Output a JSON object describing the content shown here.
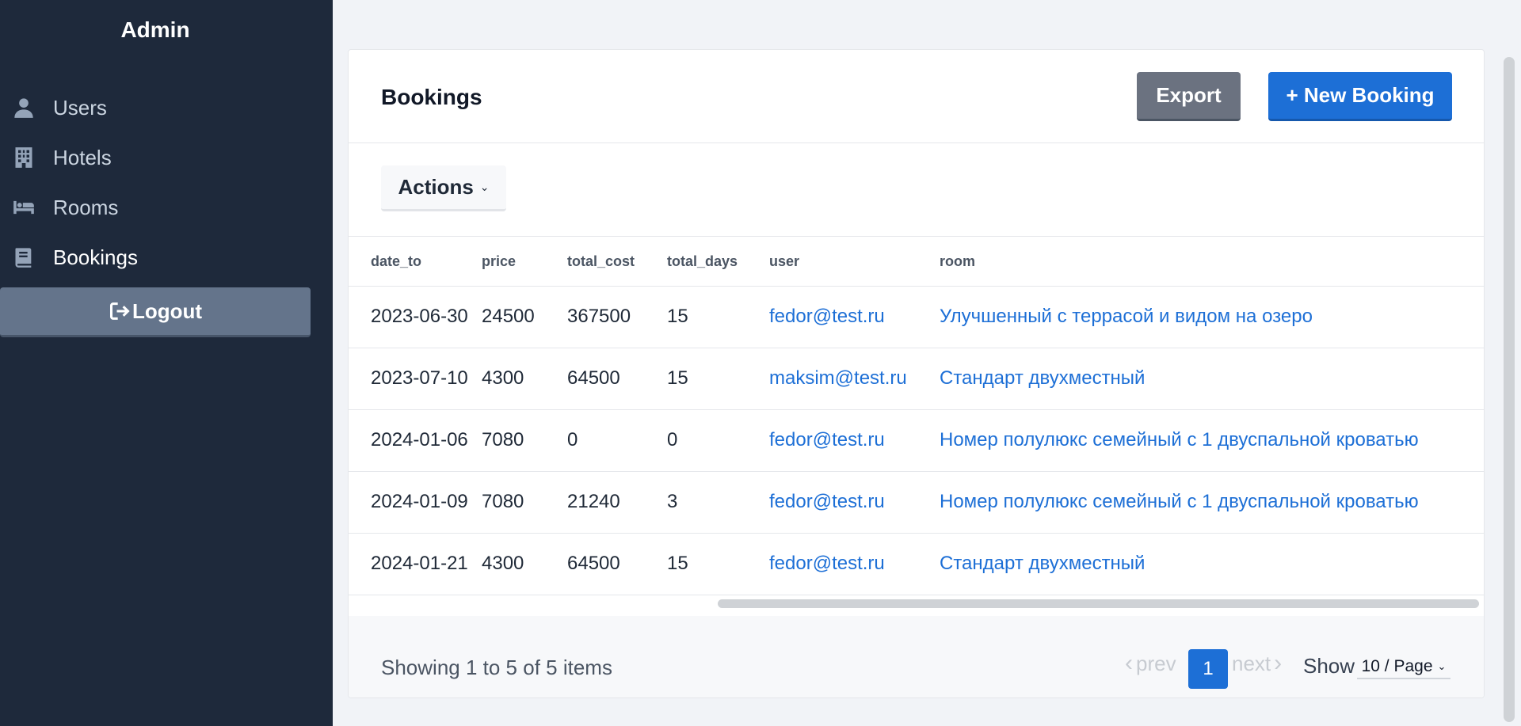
{
  "sidebar": {
    "brand": "Admin",
    "items": [
      {
        "label": "Users",
        "icon": "user-icon"
      },
      {
        "label": "Hotels",
        "icon": "building-icon"
      },
      {
        "label": "Rooms",
        "icon": "bed-icon"
      },
      {
        "label": "Bookings",
        "icon": "book-icon"
      }
    ],
    "active": "Bookings",
    "logout_label": "Logout"
  },
  "header": {
    "title": "Bookings",
    "export_label": "Export",
    "new_label": "+ New Booking"
  },
  "toolbar": {
    "actions_label": "Actions"
  },
  "table": {
    "columns": [
      "date_to",
      "price",
      "total_cost",
      "total_days",
      "user",
      "room"
    ],
    "rows": [
      [
        "2023-06-30",
        "24500",
        "367500",
        "15",
        "fedor@test.ru",
        "Улучшенный с террасой и видом на озеро"
      ],
      [
        "2023-07-10",
        "4300",
        "64500",
        "15",
        "maksim@test.ru",
        "Стандарт двухместный"
      ],
      [
        "2024-01-06",
        "7080",
        "0",
        "0",
        "fedor@test.ru",
        "Номер полулюкс семейный с 1 двуспальной кроватью"
      ],
      [
        "2024-01-09",
        "7080",
        "21240",
        "3",
        "fedor@test.ru",
        "Номер полулюкс семейный с 1 двуспальной кроватью"
      ],
      [
        "2024-01-21",
        "4300",
        "64500",
        "15",
        "fedor@test.ru",
        "Стандарт двухместный"
      ]
    ]
  },
  "footer": {
    "showing": "Showing 1 to 5 of 5 items",
    "prev": "prev",
    "current_page": "1",
    "next": "next",
    "show_label": "Show",
    "per_page": "10 / Page"
  },
  "colors": {
    "sidebar_bg": "#1e293b",
    "primary": "#1d6fd6",
    "secondary": "#6b7280"
  }
}
